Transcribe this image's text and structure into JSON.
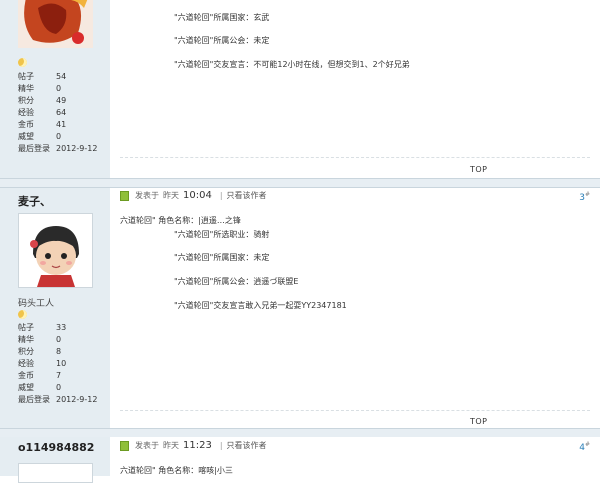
{
  "post1": {
    "stats": [
      {
        "k": "帖子",
        "v": "54"
      },
      {
        "k": "精华",
        "v": "0"
      },
      {
        "k": "积分",
        "v": "49"
      },
      {
        "k": "经验",
        "v": "64"
      },
      {
        "k": "金币",
        "v": "41"
      },
      {
        "k": "威望",
        "v": "0"
      },
      {
        "k": "最后登录",
        "v": "2012-9-12"
      }
    ],
    "lines": [
      "\"六道轮回\"所属国家：玄武",
      "\"六道轮回\"所属公会：未定",
      "\"六道轮回\"交友宣言：不可能12小时在线，但想交到1、2个好兄弟"
    ],
    "top_label": "TOP"
  },
  "post2": {
    "username": "麦子、",
    "rank": "码头工人",
    "stats": [
      {
        "k": "帖子",
        "v": "33"
      },
      {
        "k": "精华",
        "v": "0"
      },
      {
        "k": "积分",
        "v": "8"
      },
      {
        "k": "经验",
        "v": "10"
      },
      {
        "k": "金币",
        "v": "7"
      },
      {
        "k": "威望",
        "v": "0"
      },
      {
        "k": "最后登录",
        "v": "2012-9-12"
      }
    ],
    "posted_prefix": "发表于",
    "posted_day": "昨天",
    "posted_time": "10:04",
    "separator": "|",
    "author_only": "只看该作者",
    "floor": "3",
    "floor_suffix": "#",
    "lines": [
      "六道轮回\" 角色名称：|逍遥…之锋",
      "\"六道轮回\"所选职业：骑射",
      "\"六道轮回\"所属国家：未定",
      "\"六道轮回\"所属公会：逍遥づ联盟E",
      "\"六道轮回\"交友宣言敢入兄弟一起耍YY2347181"
    ],
    "top_label": "TOP"
  },
  "post3": {
    "username": "o114984882",
    "posted_prefix": "发表于",
    "posted_day": "昨天",
    "posted_time": "11:23",
    "separator": "|",
    "author_only": "只看该作者",
    "floor": "4",
    "floor_suffix": "#",
    "lines": [
      "六道轮回\" 角色名称：喀咳|小三"
    ]
  },
  "colors": {
    "sidebar_bg": "#e5edf2",
    "floor_link": "#2a7fb8",
    "post_icon": "#8fbf3a"
  }
}
